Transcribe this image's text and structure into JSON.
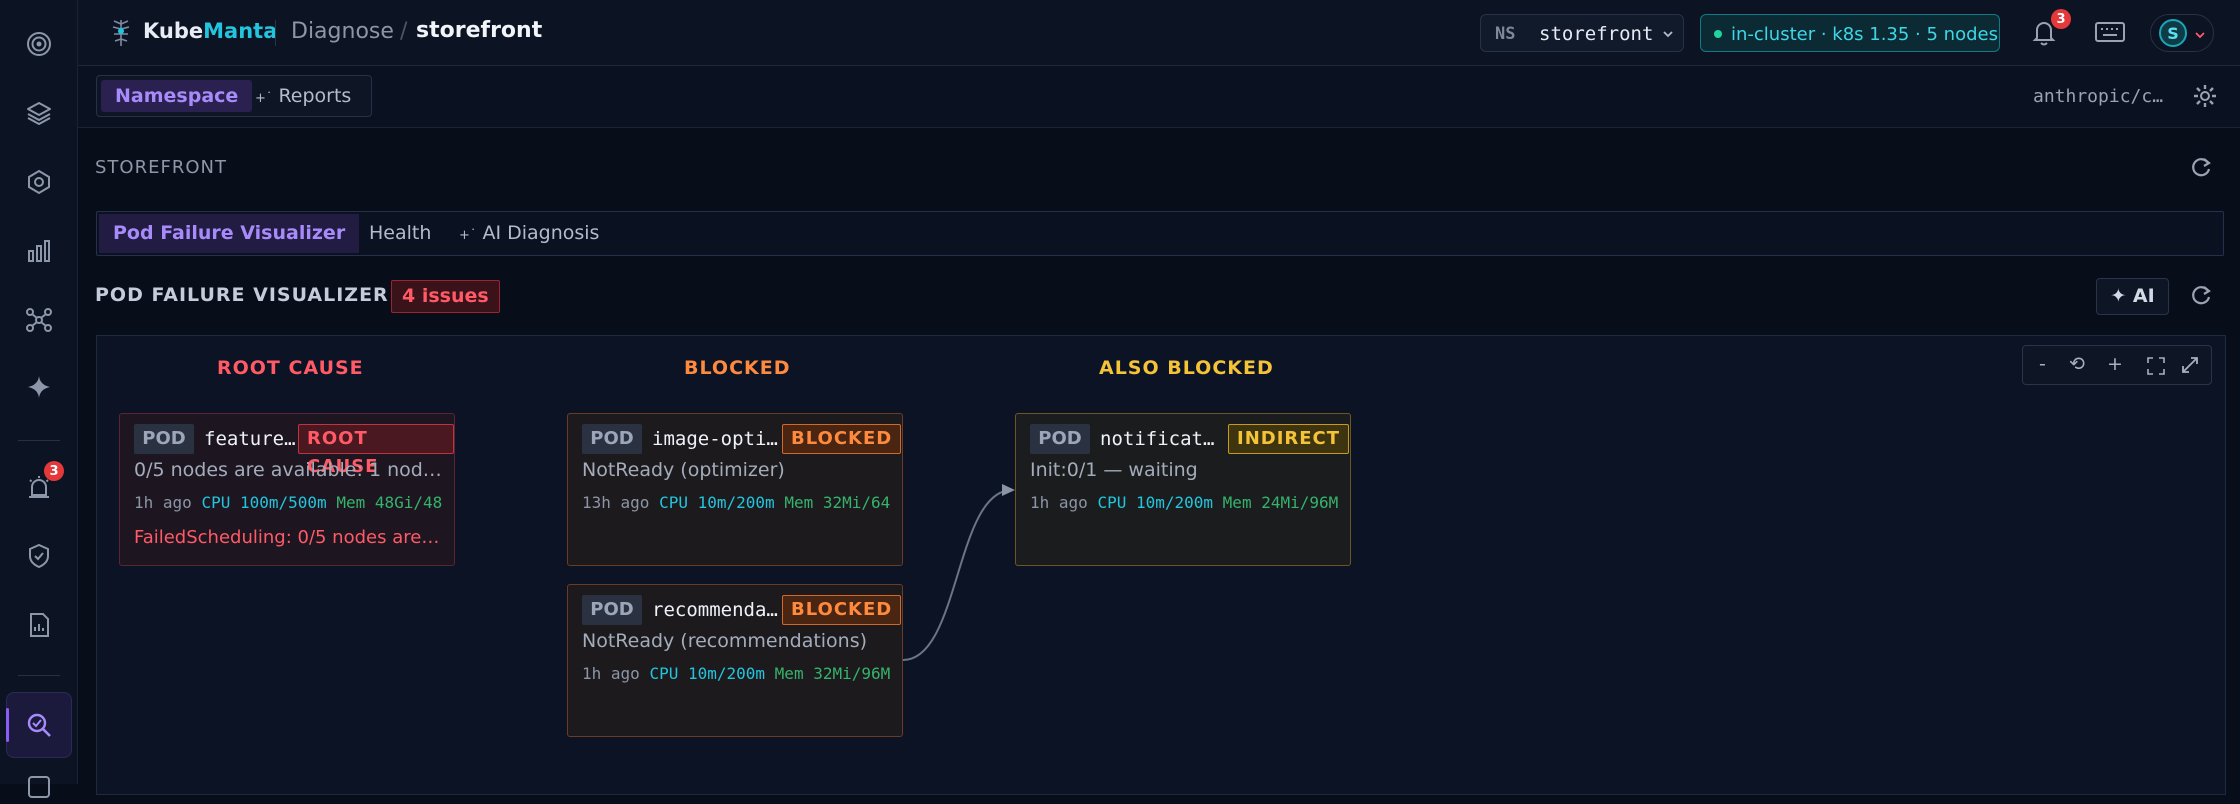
{
  "header": {
    "brand_a": "Kube",
    "brand_b": "Manta",
    "crumb1": "Diagnose",
    "crumb_sep": "/",
    "crumb2": "storefront",
    "ns_key": "NS",
    "ns_value": "storefront",
    "cluster": "in-cluster · k8s 1.35 · 5 nodes",
    "bell_count": "3"
  },
  "rail": {
    "items": [
      "target-icon",
      "layers-icon",
      "helm-icon",
      "bar-chart-icon",
      "network-icon",
      "sparkle-icon",
      "alert-icon",
      "shield-icon",
      "report-icon",
      "diagnose-icon"
    ],
    "alert_count": "3",
    "active": "diagnose-icon"
  },
  "subbar": {
    "tab1": "Namespace",
    "tab2": "Reports",
    "context": "anthropic/c…"
  },
  "section": {
    "title": "STOREFRONT",
    "tab1": "Pod Failure Visualizer",
    "tab2": "Health",
    "tab3": "AI Diagnosis"
  },
  "visualizer": {
    "title": "POD FAILURE VISUALIZER",
    "issues": "4 issues",
    "ai_label": "AI",
    "zoom": [
      "-",
      "⟲",
      "+"
    ],
    "columns": [
      "ROOT CAUSE",
      "BLOCKED",
      "ALSO BLOCKED"
    ],
    "colors": {
      "root": "#ff5a66",
      "blocked": "#ff8a3d",
      "also": "#f5c338"
    },
    "nodes": [
      {
        "kind": "POD",
        "name": "feature…",
        "tag": "ROOT CAUSE",
        "status": "0/5 nodes are available: 1 node…",
        "age": "1h ago",
        "cpu": "CPU 100m/500m",
        "mem": "Mem 48Gi/48",
        "error": "FailedScheduling: 0/5 nodes are a…"
      },
      {
        "kind": "POD",
        "name": "image-opti…",
        "tag": "BLOCKED",
        "status": "NotReady (optimizer)",
        "age": "13h ago",
        "cpu": "CPU 10m/200m",
        "mem": "Mem 32Mi/64"
      },
      {
        "kind": "POD",
        "name": "recommenda…",
        "tag": "BLOCKED",
        "status": "NotReady (recommendations)",
        "age": "1h ago",
        "cpu": "CPU 10m/200m",
        "mem": "Mem 32Mi/96M"
      },
      {
        "kind": "POD",
        "name": "notificati…",
        "tag": "INDIRECT",
        "status": "Init:0/1 — waiting",
        "age": "1h ago",
        "cpu": "CPU 10m/200m",
        "mem": "Mem 24Mi/96M"
      }
    ]
  }
}
